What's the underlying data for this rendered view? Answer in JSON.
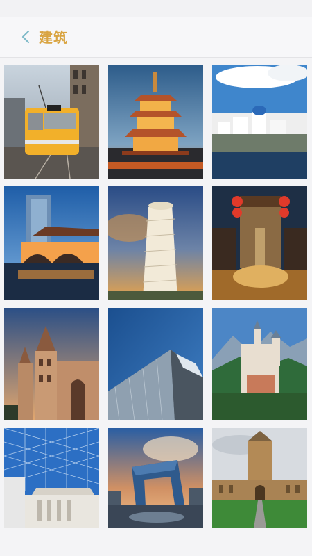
{
  "header": {
    "title": "建筑",
    "back_icon": "chevron-left-icon",
    "accent": "#d9a441"
  },
  "gallery": {
    "images": [
      {
        "subject": "yellow-tram"
      },
      {
        "subject": "pagoda-tower"
      },
      {
        "subject": "white-seaside-town"
      },
      {
        "subject": "modern-tower-and-bridge"
      },
      {
        "subject": "leaning-tower"
      },
      {
        "subject": "stone-fountain-gate"
      },
      {
        "subject": "stone-castle-bastion"
      },
      {
        "subject": "glass-curved-building"
      },
      {
        "subject": "mountain-castle"
      },
      {
        "subject": "glass-roof-atrium"
      },
      {
        "subject": "loop-tower-building"
      },
      {
        "subject": "gothic-college-tower"
      }
    ]
  }
}
